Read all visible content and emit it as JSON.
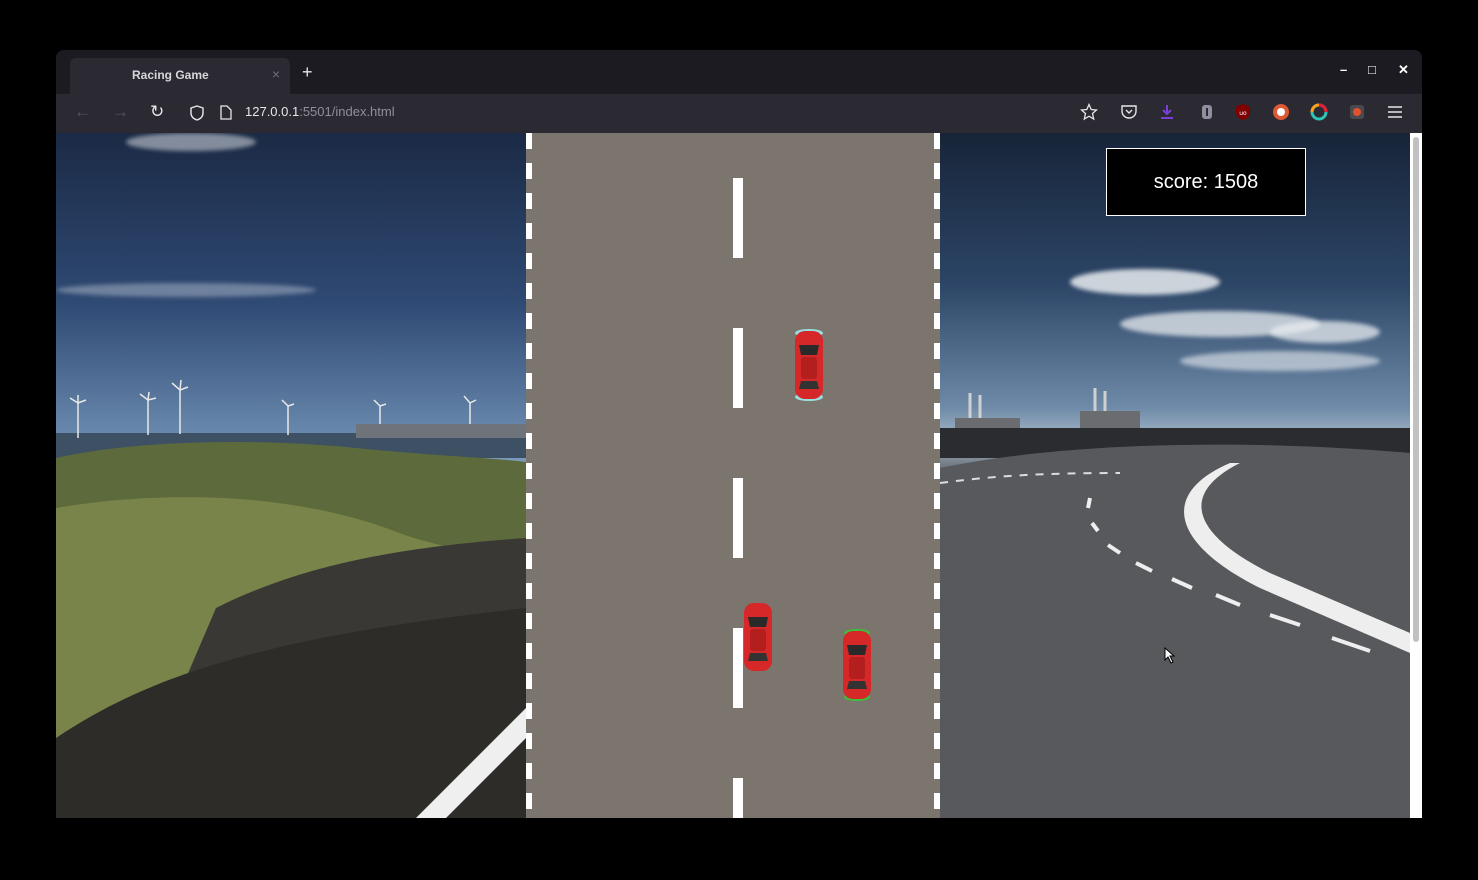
{
  "browser": {
    "tab_title": "Racing Game",
    "tab_close": "×",
    "new_tab": "+",
    "url_host": "127.0.0.1",
    "url_rest": ":5501/index.html",
    "window_controls": {
      "minimize": "–",
      "maximize": "□",
      "close": "✕"
    },
    "nav": {
      "back": "←",
      "forward": "→",
      "reload": "↻"
    }
  },
  "game": {
    "score_label": "score:",
    "score_value": "1508",
    "car_color": "#d62828",
    "road_color": "#7b756d"
  }
}
